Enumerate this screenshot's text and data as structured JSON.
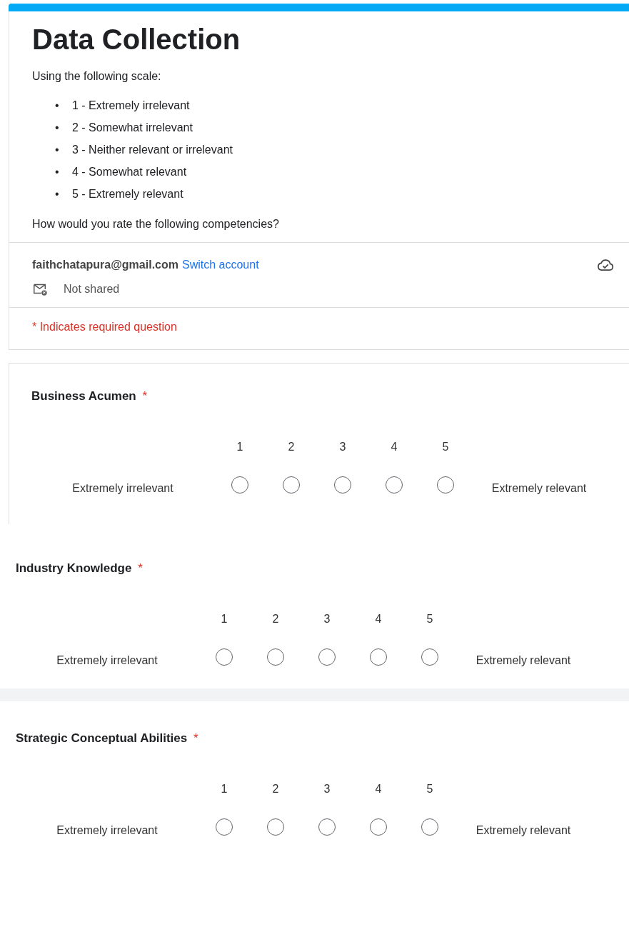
{
  "form": {
    "title": "Data Collection",
    "intro": "Using the following scale:",
    "scale": [
      {
        "bullet": "•",
        "text": "1 - Extremely irrelevant"
      },
      {
        "bullet": "•",
        "text": "2 - Somewhat irrelevant"
      },
      {
        "bullet": "•",
        "text": "3 - Neither relevant or irrelevant"
      },
      {
        "bullet": "•",
        "text": "4 - Somewhat relevant"
      },
      {
        "bullet": "•",
        "text": "5 - Extremely relevant"
      }
    ],
    "prompt": "How would you rate the following competencies?"
  },
  "account": {
    "email": "faithchatapura@gmail.com",
    "switch_link": "Switch account",
    "sharing": "Not shared"
  },
  "required_note": "* Indicates required question",
  "questions": [
    {
      "title": "Business Acumen",
      "required_mark": "*",
      "low_label": "Extremely irrelevant",
      "high_label": "Extremely relevant",
      "options": [
        {
          "label": "1",
          "selected": false
        },
        {
          "label": "2",
          "selected": false
        },
        {
          "label": "3",
          "selected": false
        },
        {
          "label": "4",
          "selected": false
        },
        {
          "label": "5",
          "selected": false
        }
      ]
    },
    {
      "title": "Industry Knowledge",
      "required_mark": "*",
      "low_label": "Extremely irrelevant",
      "high_label": "Extremely relevant",
      "options": [
        {
          "label": "1",
          "selected": false
        },
        {
          "label": "2",
          "selected": false
        },
        {
          "label": "3",
          "selected": false
        },
        {
          "label": "4",
          "selected": false
        },
        {
          "label": "5",
          "selected": false
        }
      ]
    },
    {
      "title": "Strategic Conceptual Abilities",
      "required_mark": "*",
      "low_label": "Extremely irrelevant",
      "high_label": "Extremely relevant",
      "options": [
        {
          "label": "1",
          "selected": false
        },
        {
          "label": "2",
          "selected": false
        },
        {
          "label": "3",
          "selected": false
        },
        {
          "label": "4",
          "selected": false
        },
        {
          "label": "5",
          "selected": false
        }
      ]
    }
  ]
}
